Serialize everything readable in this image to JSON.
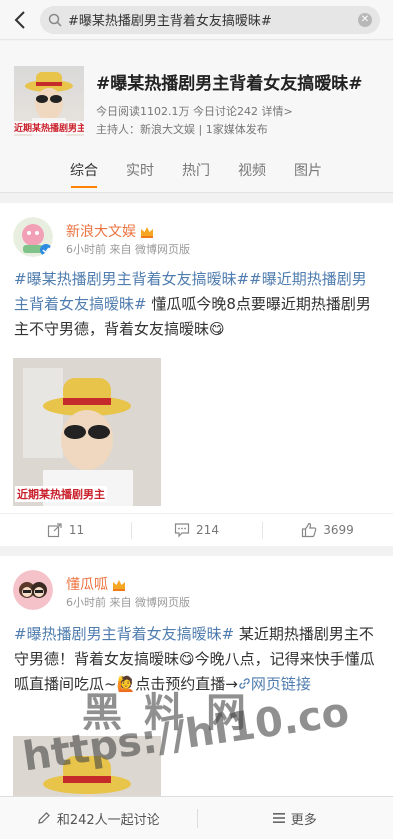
{
  "search": {
    "query": "#曝某热播剧男主背着女友搞暧昧#"
  },
  "topic": {
    "cover_caption": "近期某热播剧男主",
    "title": "#曝某热播剧男主背着女友搞暧昧#",
    "stats": "今日阅读1102.1万 今日讨论242 详情>",
    "host": "主持人：新浪大文娱 | 1家媒体发布"
  },
  "tabs": [
    "综合",
    "实时",
    "热门",
    "视频",
    "图片"
  ],
  "posts": [
    {
      "author": "新浪大文娱",
      "time": "6小时前 来自 微博网页版",
      "tag1": "#曝某热播剧男主背着女友搞暧昧#",
      "tag2": "#曝近期热播剧男主背着女友搞暧昧#",
      "text": " 懂瓜呱今晚8点要曝近期热播剧男主不守男德，背着女友搞暧昧",
      "emoji": "😋",
      "image_caption": "近期某热播剧男主",
      "reposts": "11",
      "comments": "214",
      "likes": "3699"
    },
    {
      "author": "懂瓜呱",
      "time": "6小时前 来自 微博网页版",
      "tag1": "#曝热播剧男主背着女友搞暧昧#",
      "text": " 某近期热播剧男主不守男德！背着女友搞暧昧",
      "emoji": "😋",
      "text2": "今晚八点，记得来快手懂瓜呱直播间吃瓜~",
      "emoji2": "🙋",
      "text3": "点击预约直播→",
      "link": "网页链接"
    }
  ],
  "bottom": {
    "discuss": "和242人一起讨论",
    "more": "更多"
  },
  "watermark": {
    "line1": "黑料网",
    "line2": "https://hl10.co"
  },
  "colors": {
    "accent": "#ff8200",
    "tag": "#507daf",
    "author": "#eb7340"
  }
}
